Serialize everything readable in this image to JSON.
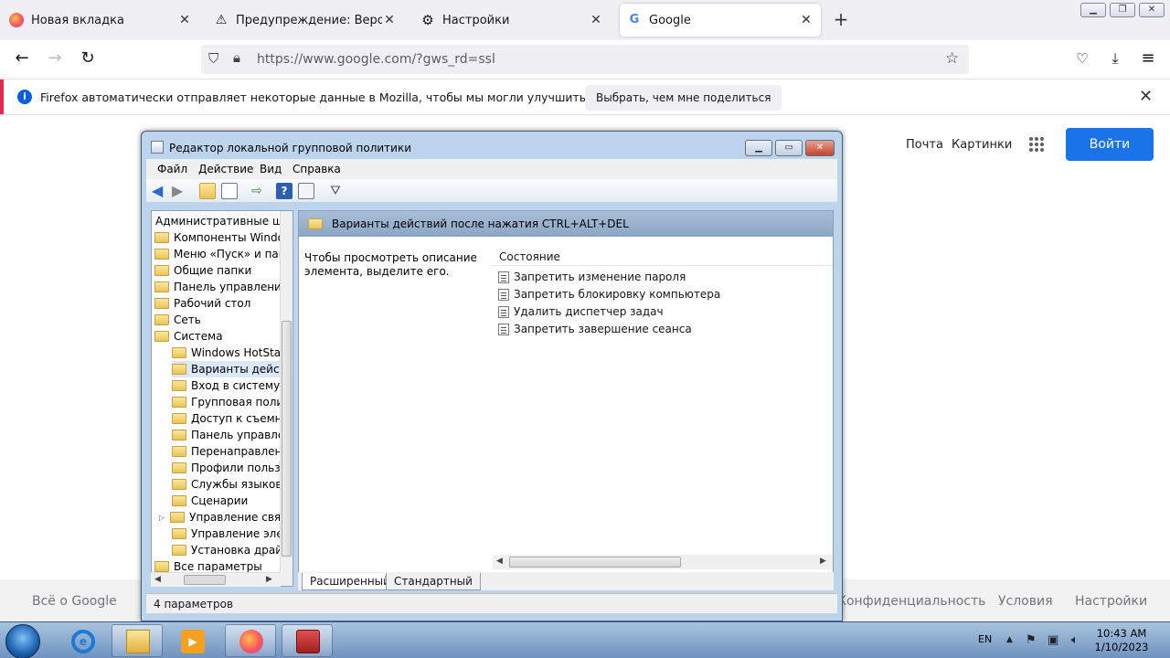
{
  "browser": {
    "tabs": [
      {
        "label": "Новая вкладка",
        "active": false
      },
      {
        "label": "Предупреждение: Вероятная у",
        "active": false
      },
      {
        "label": "Настройки",
        "active": false
      },
      {
        "label": "Google",
        "active": true
      }
    ],
    "url": "https://www.google.com/?gws_rd=ssl",
    "notification": {
      "text": "Firefox автоматически отправляет некоторые данные в Mozilla, чтобы мы могли улучшить ваш браузер.",
      "button": "Выбрать, чем мне поделиться"
    }
  },
  "google": {
    "top_links": [
      "Почта",
      "Картинки"
    ],
    "signin": "Войти",
    "footer_left": "Всё о Google",
    "footer_right": [
      "Конфиденциальность",
      "Условия",
      "Настройки"
    ]
  },
  "gpo": {
    "title": "Редактор локальной групповой политики",
    "menu": [
      "Файл",
      "Действие",
      "Вид",
      "Справка"
    ],
    "tree": [
      {
        "label": "Административные шаб",
        "indent": 0,
        "folder": false
      },
      {
        "label": "Компоненты Windov",
        "indent": 1,
        "folder": true
      },
      {
        "label": "Меню «Пуск» и пане",
        "indent": 1,
        "folder": true
      },
      {
        "label": "Общие папки",
        "indent": 1,
        "folder": true
      },
      {
        "label": "Панель управления",
        "indent": 1,
        "folder": true
      },
      {
        "label": "Рабочий стол",
        "indent": 1,
        "folder": true
      },
      {
        "label": "Сеть",
        "indent": 1,
        "folder": true
      },
      {
        "label": "Система",
        "indent": 1,
        "folder": true
      },
      {
        "label": "Windows HotStart",
        "indent": 2,
        "folder": true
      },
      {
        "label": "Варианты действ",
        "indent": 2,
        "folder": true,
        "selected": true
      },
      {
        "label": "Вход в систему",
        "indent": 2,
        "folder": true
      },
      {
        "label": "Групповая полит",
        "indent": 2,
        "folder": true
      },
      {
        "label": "Доступ к съемны",
        "indent": 2,
        "folder": true
      },
      {
        "label": "Панель управлен",
        "indent": 2,
        "folder": true
      },
      {
        "label": "Перенаправлени",
        "indent": 2,
        "folder": true
      },
      {
        "label": "Профили пользо",
        "indent": 2,
        "folder": true
      },
      {
        "label": "Службы языковь",
        "indent": 2,
        "folder": true
      },
      {
        "label": "Сценарии",
        "indent": 2,
        "folder": true
      },
      {
        "label": "Управление связ",
        "indent": 2,
        "folder": true,
        "expandable": true
      },
      {
        "label": "Управление элек",
        "indent": 2,
        "folder": true
      },
      {
        "label": "Установка драйве",
        "indent": 2,
        "folder": true
      },
      {
        "label": "Все параметры",
        "indent": 1,
        "folder": true
      }
    ],
    "header": "Варианты действий после нажатия CTRL+ALT+DEL",
    "description": "Чтобы просмотреть описание элемента, выделите его.",
    "column": "Состояние",
    "settings": [
      "Запретить изменение пароля",
      "Запретить блокировку компьютера",
      "Удалить диспетчер задач",
      "Запретить завершение сеанса"
    ],
    "tabs": [
      "Расширенный",
      "Стандартный"
    ],
    "status": "4 параметров"
  },
  "taskbar": {
    "lang": "EN",
    "time": "10:43 AM",
    "date": "1/10/2023"
  }
}
